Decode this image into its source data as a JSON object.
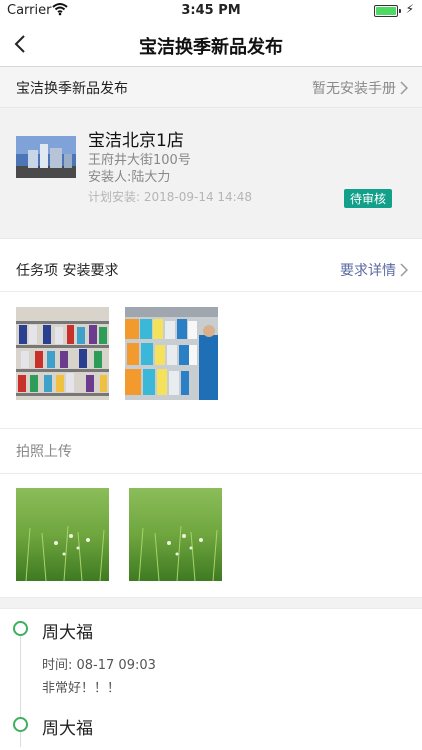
{
  "status_bar": {
    "carrier": "Carrier",
    "time": "3:45 PM"
  },
  "nav": {
    "title": "宝洁换季新品发布",
    "back_icon": "chevron-left-icon"
  },
  "manual_row": {
    "label": "宝洁换季新品发布",
    "link": "暂无安装手册"
  },
  "store": {
    "name": "宝洁北京1店",
    "address": "王府井大街100号",
    "installer": "安装人:陆大力",
    "planned": "计划安装: 2018-09-14 14:48",
    "status": "待审核",
    "status_color": "#12a08a"
  },
  "task_row": {
    "label": "任务项 安装要求",
    "link": "要求详情",
    "link_color": "#5b6aa0"
  },
  "upload": {
    "label": "拍照上传"
  },
  "timeline": [
    {
      "user": "周大福",
      "time": "时间: 08-17 09:03",
      "message": "非常好！！！"
    },
    {
      "user": "周大福"
    }
  ],
  "accent_color": "#3fae5e"
}
